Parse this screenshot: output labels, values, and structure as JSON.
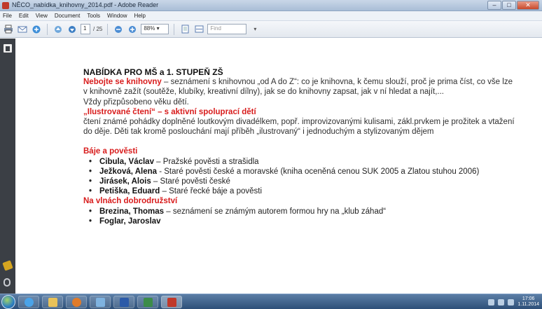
{
  "window": {
    "title": "NĚCO_nabídka_knihovny_2014.pdf - Adobe Reader",
    "buttons": {
      "minimize": "–",
      "maximize": "□",
      "close": "✕"
    }
  },
  "menubar": {
    "items": [
      "File",
      "Edit",
      "View",
      "Document",
      "Tools",
      "Window",
      "Help"
    ]
  },
  "toolbar": {
    "page_current": "1",
    "page_total": "/ 25",
    "zoom": "88% ▾",
    "find_placeholder": "Find"
  },
  "document": {
    "heading": "NABÍDKA PRO MŠ a 1. STUPEŇ ZŠ",
    "section1": {
      "title": "Nebojte se knihovny",
      "text": " – seznámení s knihovnou „od A do Z“: co je knihovna, k čemu slouží, proč je prima číst, co vše lze v knihovně zažít (soutěže, klubíky, kreativní dílny), jak se do knihovny zapsat, jak v ní hledat a najít,...",
      "note": "Vždy přizpůsobeno věku dětí."
    },
    "section2": {
      "title": "„Ilustrované čtení“ – s aktivní spoluprací dětí",
      "text": "čtení známé pohádky doplněné loutkovým divadélkem, popř. improvizovanými kulisami, zákl.prvkem je prožitek a vtažení do děje. Děti tak kromě poslouchání mají příběh „ilustrovaný“ i jednoduchým a stylizovaným dějem"
    },
    "section3": {
      "title": "Báje a pověsti",
      "items": [
        {
          "author": "Cibula, Václav",
          "desc": " – Pražské pověsti a strašidla"
        },
        {
          "author": "Ježková, Alena",
          "desc": " - Staré pověsti české a moravské (kniha oceněná cenou SUK 2005 a Zlatou stuhou 2006)"
        },
        {
          "author": "Jirásek, Alois",
          "desc": " – Staré pověsti české"
        },
        {
          "author": "Petiška, Eduard",
          "desc": " – Staré řecké báje a pověsti"
        }
      ]
    },
    "section4": {
      "title": "Na vlnách dobrodružství",
      "items": [
        {
          "author": "Brezina, Thomas",
          "desc": " – seznámení se známým autorem formou hry na „klub záhad“"
        },
        {
          "author": "Foglar, Jaroslav",
          "desc": ""
        }
      ]
    }
  },
  "taskbar": {
    "tasks": [
      "ie",
      "folder",
      "media",
      "paint",
      "word",
      "excel",
      "reader"
    ],
    "clock_time": "17:06",
    "clock_date": "1.11.2014"
  },
  "colors": {
    "accent_red": "#d81c1c",
    "nav_dark": "#3b3f45",
    "taskbar": "#2d4f78"
  }
}
